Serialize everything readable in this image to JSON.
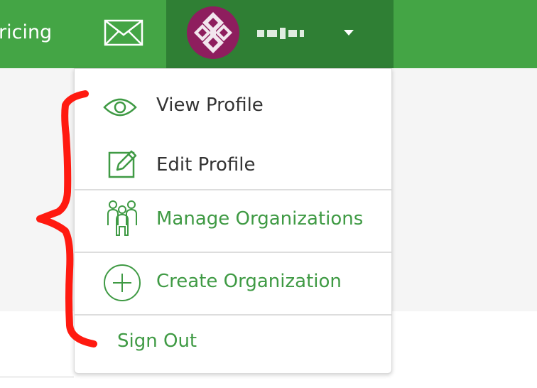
{
  "navbar": {
    "partial_link_label": "ricing",
    "mail_icon": "envelope-icon",
    "user": {
      "avatar_icon": "avatar-pattern",
      "username_obscured": "▪▪ ▪▪ ▪",
      "caret_icon": "caret-down-icon"
    }
  },
  "dropdown": {
    "items": [
      {
        "label": "View Profile",
        "icon": "eye-icon"
      },
      {
        "label": "Edit Profile",
        "icon": "pencil-edit-icon"
      },
      {
        "label": "Manage Organizations",
        "icon": "people-group-icon"
      },
      {
        "label": "Create Organization",
        "icon": "plus-circle-icon"
      },
      {
        "label": "Sign Out",
        "icon": ""
      }
    ]
  },
  "annotation": {
    "type": "red hand-drawn curly brace",
    "color": "#ff1a10"
  },
  "colors": {
    "navbar": "#44a545",
    "navbar_active": "#2f7f34",
    "accent_text": "#3f9a44",
    "avatar": "#8e1e5e"
  }
}
